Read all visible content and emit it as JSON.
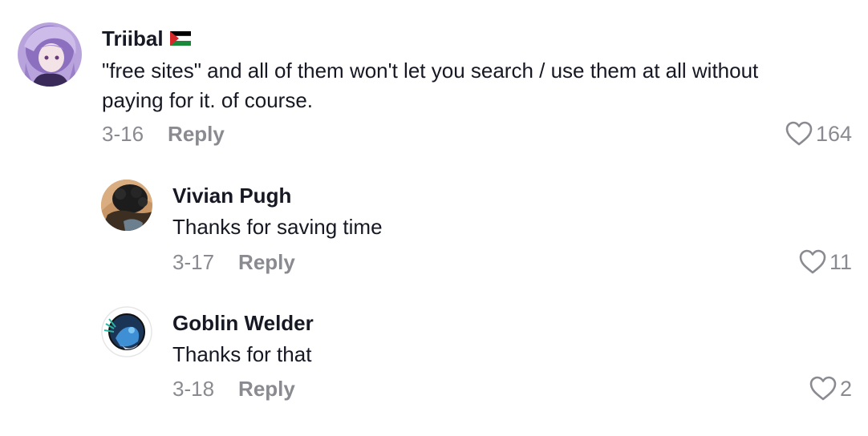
{
  "comments": [
    {
      "username": "Triibal",
      "flag_icon": "palestine-flag-icon",
      "text": "\"free sites\" and all of them won't let you search / use them at all without paying for it. of course.",
      "date": "3-16",
      "reply_label": "Reply",
      "likes": "164",
      "avatar_colors": [
        "#c7b3e6",
        "#6e4e9b"
      ]
    },
    {
      "username": "Vivian Pugh",
      "text": "Thanks for saving time",
      "date": "3-17",
      "reply_label": "Reply",
      "likes": "11",
      "avatar_colors": [
        "#b9814f",
        "#2a2a2a"
      ]
    },
    {
      "username": "Goblin Welder",
      "text": "Thanks for that",
      "date": "3-18",
      "reply_label": "Reply",
      "likes": "2",
      "avatar_colors": [
        "#1f3f6b",
        "#5fa9e0"
      ]
    }
  ],
  "colors": {
    "primary_text": "#161823",
    "secondary_text": "#8a8b91"
  }
}
